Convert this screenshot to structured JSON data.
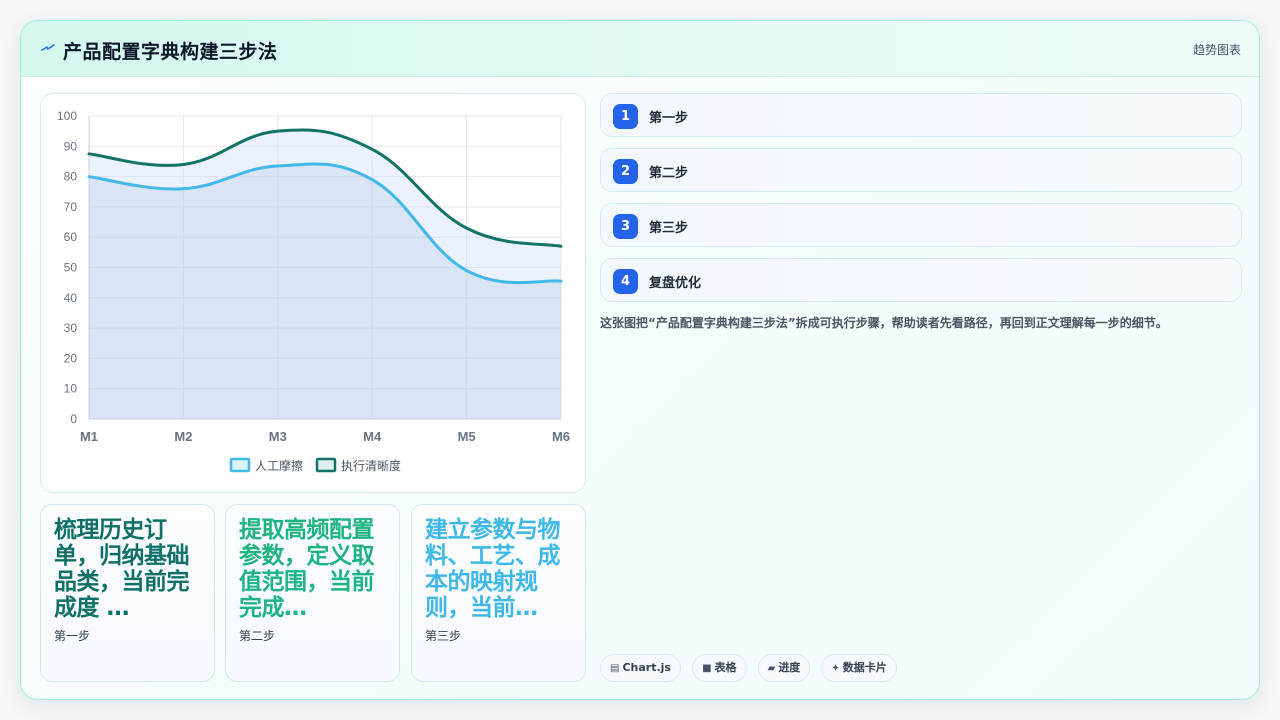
{
  "header": {
    "title": "产品配置字典构建三步法",
    "tag": "趋势图表"
  },
  "chart_data": {
    "type": "area",
    "categories": [
      "M1",
      "M2",
      "M3",
      "M4",
      "M5",
      "M6"
    ],
    "ylim": [
      0,
      100
    ],
    "yticks": [
      0,
      10,
      20,
      30,
      40,
      50,
      60,
      70,
      80,
      90,
      100
    ],
    "series": [
      {
        "name": "人工摩擦",
        "values": [
          80,
          76,
          83.5,
          79,
          49,
          45.5
        ],
        "color": "#41b8e8"
      },
      {
        "name": "执行清晰度",
        "values": [
          87.5,
          84,
          95,
          89,
          63,
          57
        ],
        "color": "#137367"
      }
    ],
    "legend": "bottom"
  },
  "stats": [
    {
      "value": "梳理历史订单，归纳基础品类，当前完成度 …",
      "label": "第一步"
    },
    {
      "value": "提取高频配置参数，定义取值范围，当前完成…",
      "label": "第二步"
    },
    {
      "value": "建立参数与物料、工艺、成本的映射规则，当前…",
      "label": "第三步"
    }
  ],
  "steps": [
    {
      "num": "1",
      "label": "第一步"
    },
    {
      "num": "2",
      "label": "第二步"
    },
    {
      "num": "3",
      "label": "第三步"
    },
    {
      "num": "4",
      "label": "复盘优化"
    }
  ],
  "description": "这张图把“产品配置字典构建三步法”拆成可执行步骤，帮助读者先看路径，再回到正文理解每一步的细节。",
  "chips": [
    {
      "icon": "chart-icon",
      "label": "Chart.js"
    },
    {
      "icon": "table-icon",
      "label": "表格"
    },
    {
      "icon": "progress-icon",
      "label": "进度"
    },
    {
      "icon": "card-icon",
      "label": "数据卡片"
    }
  ]
}
